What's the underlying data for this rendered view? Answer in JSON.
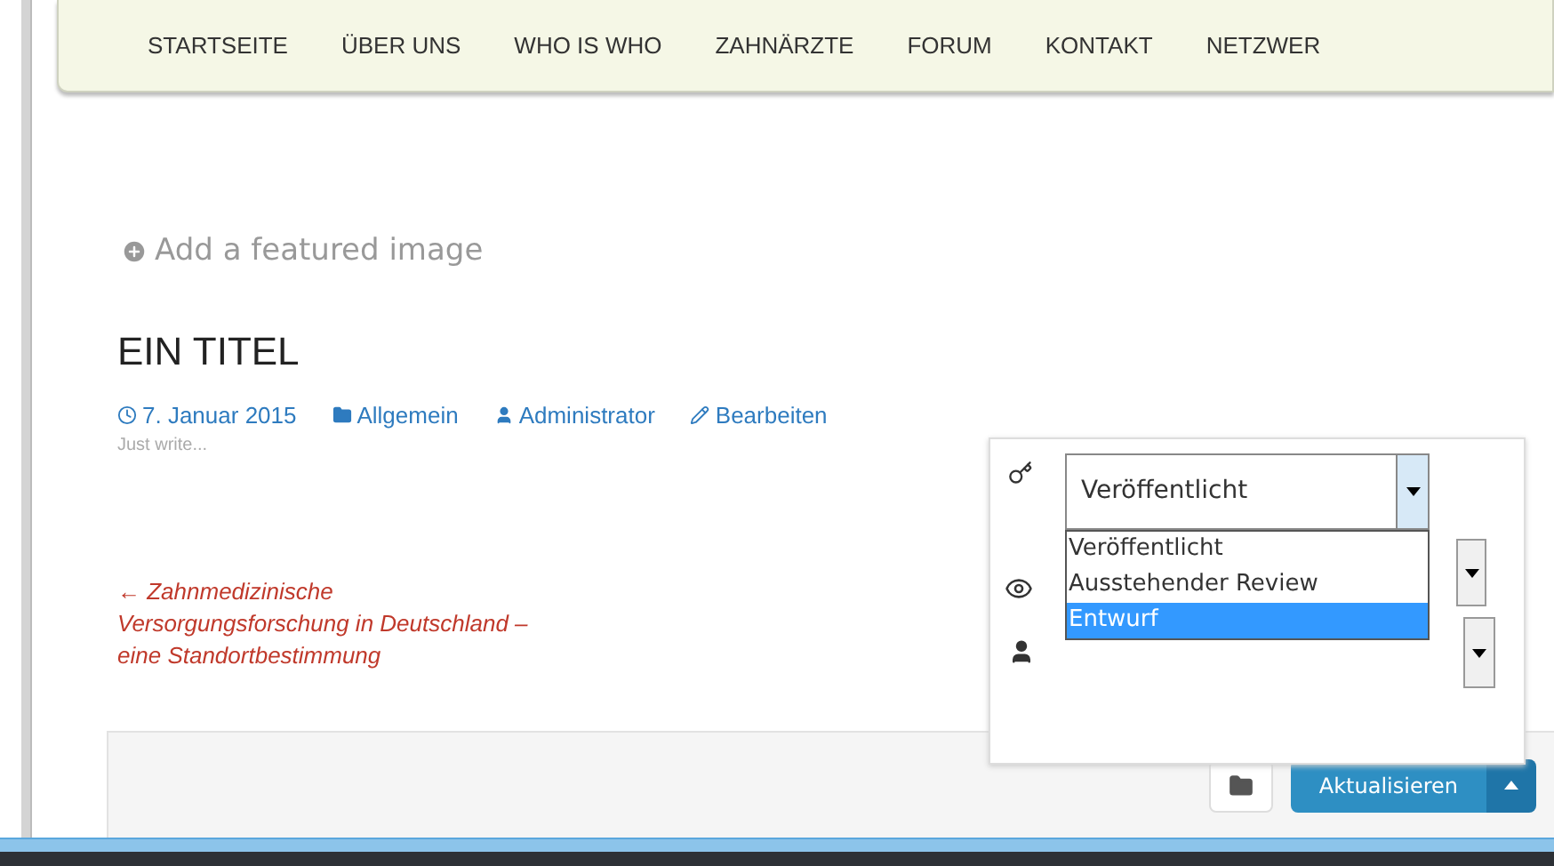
{
  "nav": [
    "STARTSEITE",
    "ÜBER UNS",
    "WHO IS WHO",
    "ZAHNÄRZTE",
    "FORUM",
    "KONTAKT",
    "NETZWER"
  ],
  "featured_image": "Add a featured image",
  "post": {
    "title": "EIN TITEL",
    "meta": [
      {
        "kind": "date",
        "text": "7. Januar 2015"
      },
      {
        "kind": "category",
        "text": "Allgemein"
      },
      {
        "kind": "author",
        "text": "Administrator"
      },
      {
        "kind": "edit",
        "text": "Bearbeiten"
      }
    ],
    "excerpt": "Just write...",
    "previous_link": "← Zahnmedizinische\nVersorgungsforschung in Deutschland –\neine Standortbestimmung"
  },
  "status_popup": {
    "status_select": {
      "value": "Veröffentlicht"
    },
    "options": [
      {
        "label": "Veröffentlicht",
        "selected": false
      },
      {
        "label": "Ausstehender Review",
        "selected": false
      },
      {
        "label": "Entwurf",
        "selected": true
      }
    ]
  },
  "toolbar": {
    "primary_button": "Aktualisieren"
  }
}
